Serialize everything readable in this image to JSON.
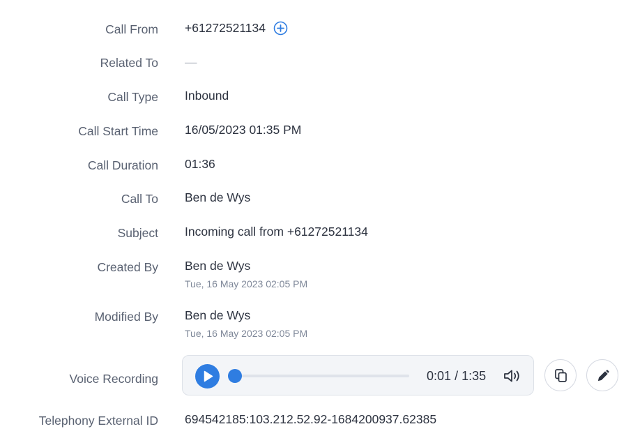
{
  "fields": [
    {
      "label": "Call From",
      "value": "+61272521134"
    },
    {
      "label": "Related To",
      "value": "—"
    },
    {
      "label": "Call Type",
      "value": "Inbound"
    },
    {
      "label": "Call Start Time",
      "value": "16/05/2023 01:35 PM"
    },
    {
      "label": "Call Duration",
      "value": "01:36"
    },
    {
      "label": "Call To",
      "value": "Ben de Wys"
    },
    {
      "label": "Subject",
      "value": "Incoming call from +61272521134"
    },
    {
      "label": "Created By",
      "value": "Ben de Wys",
      "sub": "Tue, 16 May 2023 02:05 PM"
    },
    {
      "label": "Modified By",
      "value": "Ben de Wys",
      "sub": "Tue, 16 May 2023 02:05 PM"
    },
    {
      "label": "Voice Recording"
    },
    {
      "label": "Telephony External ID",
      "value": "694542185:103.212.52.92-1684200937.62385"
    }
  ],
  "player": {
    "current_time": "0:01",
    "separator": "/",
    "total_time": "1:35",
    "progress_fraction": 0.01
  },
  "icons": {
    "add": "plus-circle-icon",
    "play": "play-icon",
    "volume": "volume-icon",
    "copy": "copy-icon",
    "edit": "pencil-icon"
  },
  "colors": {
    "accent": "#2f7de1",
    "label": "#5a6272",
    "value": "#2d3340",
    "subtext": "#7f8899"
  }
}
